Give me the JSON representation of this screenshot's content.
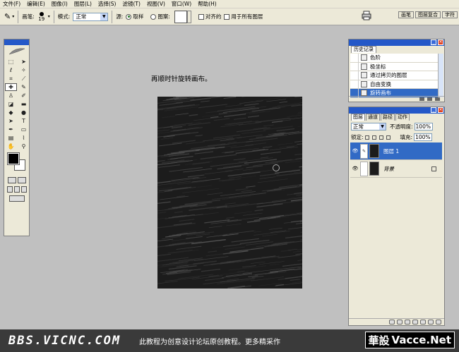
{
  "menubar": {
    "items": [
      "文件(F)",
      "编辑(E)",
      "图像(I)",
      "图层(L)",
      "选择(S)",
      "滤镜(T)",
      "视图(V)",
      "窗口(W)",
      "帮助(H)"
    ]
  },
  "options": {
    "brush_label": "画笔:",
    "brush_size": "19",
    "mode_label": "模式:",
    "mode_value": "正常",
    "source_label": "源:",
    "sampled_label": "取样",
    "pattern_label": "图案:",
    "aligned_label": "对齐的",
    "all_layers_label": "用于所有图层",
    "well_tabs": [
      "画笔",
      "图层复合",
      "字符"
    ]
  },
  "canvas": {
    "instruction": "再顺时针旋转画布。"
  },
  "history": {
    "tab": "历史记录",
    "items": [
      "色阶",
      "极坐标",
      "通过拷贝的图层",
      "自由变换",
      "旋转画布"
    ],
    "selected_index": 4
  },
  "layers": {
    "tabs": [
      "图层",
      "通道",
      "路径",
      "动作"
    ],
    "blend_mode": "正常",
    "opacity_label": "不透明度:",
    "opacity_value": "100%",
    "lock_label": "锁定:",
    "fill_label": "填充:",
    "fill_value": "100%",
    "items": [
      {
        "name": "图层 1",
        "selected": true
      },
      {
        "name": "背景",
        "selected": false
      }
    ]
  },
  "banner": {
    "site": "BBS.VICNC.COM",
    "caption": "此教程为创意设计论坛原创教程。更多精采作",
    "logo_cn": "華設",
    "logo_en": "Vacce.Net"
  }
}
